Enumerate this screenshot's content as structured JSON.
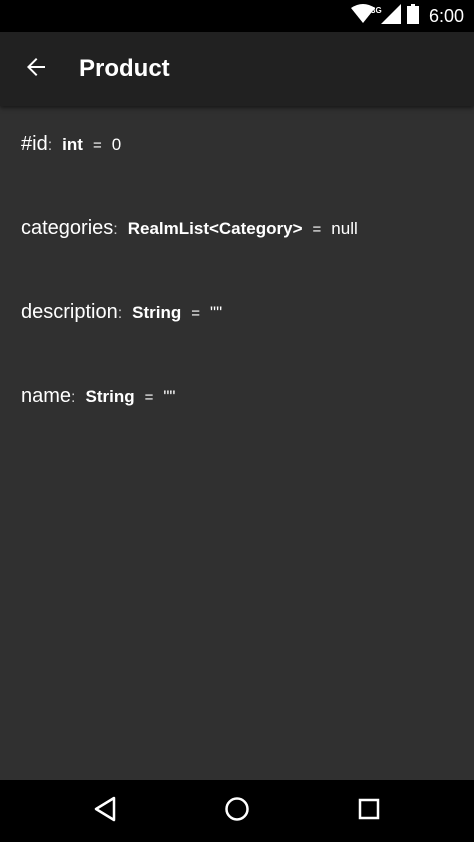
{
  "status_bar": {
    "network_label": "3G",
    "time": "6:00",
    "icons": [
      "wifi-icon",
      "signal-icon",
      "battery-icon"
    ]
  },
  "app_bar": {
    "title": "Product",
    "back_icon": "arrow-back-icon"
  },
  "fields": [
    {
      "name": "#id",
      "colon": ":",
      "type": "int",
      "eq": "=",
      "value": "0"
    },
    {
      "name": "categories",
      "colon": ":",
      "type": "RealmList<Category>",
      "eq": "=",
      "value": "null"
    },
    {
      "name": "description",
      "colon": ":",
      "type": "String",
      "eq": "=",
      "value": "\"\""
    },
    {
      "name": "name",
      "colon": ":",
      "type": "String",
      "eq": "=",
      "value": "\"\""
    }
  ],
  "nav_bar": {
    "icons": [
      "back-triangle-icon",
      "home-circle-icon",
      "recents-square-icon"
    ]
  },
  "colors": {
    "background": "#303030",
    "app_bar": "#212121",
    "status_bar": "#000000",
    "text": "#ffffff"
  }
}
